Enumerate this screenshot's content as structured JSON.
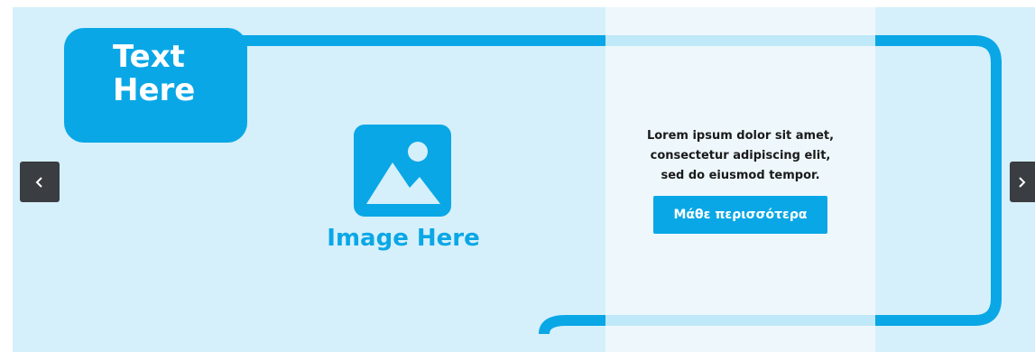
{
  "banner": {
    "headline": "Text\nHere",
    "image_placeholder_label": "Image Here",
    "image_icon": "image-icon",
    "body_text": "Lorem ipsum dolor sit amet,\nconsectetur adipiscing elit,\nsed do eiusmod tempor.",
    "cta_label": "Μάθε περισσότερα"
  },
  "carousel": {
    "prev_icon": "chevron-left-icon",
    "next_icon": "chevron-right-icon"
  },
  "colors": {
    "accent": "#0aa7e6",
    "background": "#d5f0fb",
    "panel": "#eef8fc",
    "arrow_bg": "#3a3d41"
  }
}
